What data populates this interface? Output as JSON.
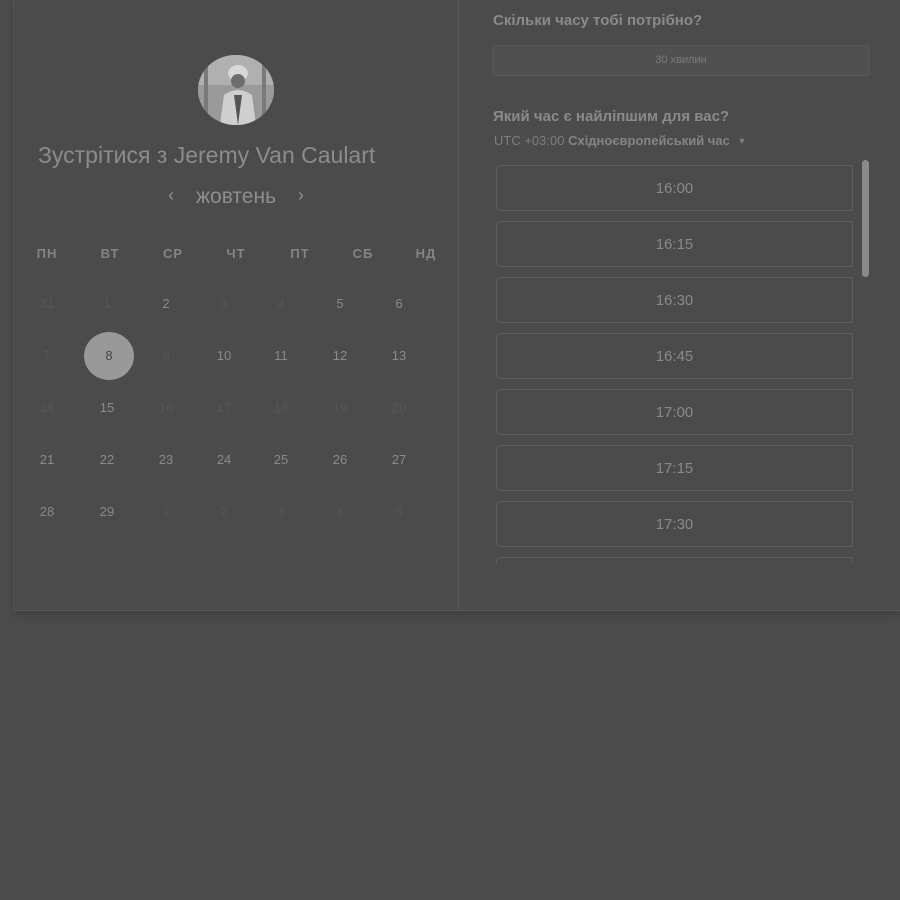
{
  "calendar": {
    "title_prefix": "Зустрітися з",
    "host_name": "Jeremy Van Caulart",
    "month": "жовтень",
    "prev_label": "‹",
    "next_label": "›",
    "weekdays": [
      "ПН",
      "ВТ",
      "СР",
      "ЧТ",
      "ПТ",
      "СБ",
      "НД"
    ],
    "weeks": [
      [
        "31",
        "1",
        "2",
        "3",
        "4",
        "5",
        "6"
      ],
      [
        "7",
        "8",
        "9",
        "10",
        "11",
        "12",
        "13"
      ],
      [
        "14",
        "15",
        "16",
        "17",
        "18",
        "19",
        "20"
      ],
      [
        "21",
        "22",
        "23",
        "24",
        "25",
        "26",
        "27"
      ],
      [
        "28",
        "29",
        "1",
        "2",
        "3",
        "4",
        "5"
      ]
    ],
    "selected_day": "8"
  },
  "duration": {
    "question": "Скільки часу тобі потрібно?",
    "value": "30 хвилин"
  },
  "time": {
    "question": "Який час є найліпшим для вас?",
    "utc": "UTC +03:00",
    "zone": "Східноєвропейський час",
    "slots": [
      "16:00",
      "16:15",
      "16:30",
      "16:45",
      "17:00",
      "17:15",
      "17:30"
    ]
  },
  "colors": {
    "background": "#4b4b4b",
    "selected_day": "#999999"
  }
}
